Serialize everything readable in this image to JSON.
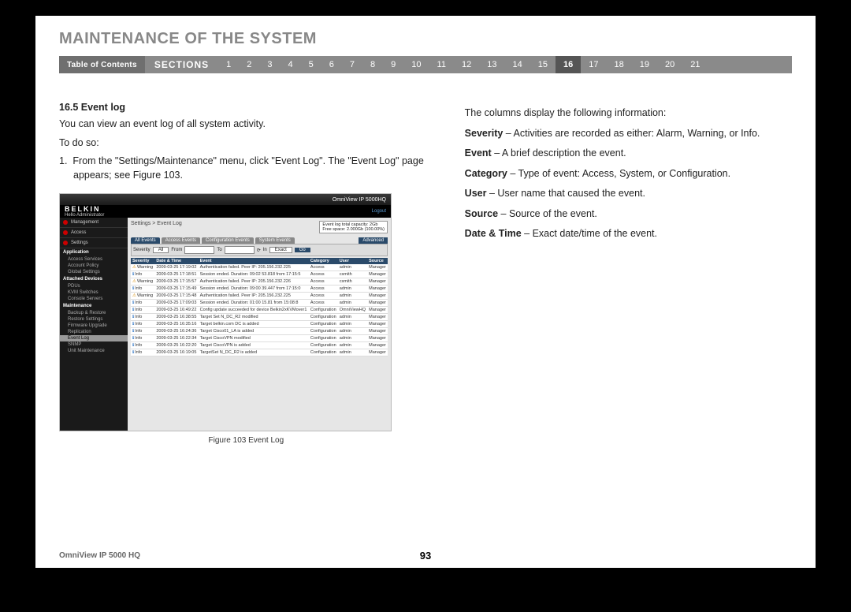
{
  "page": {
    "title": "MAINTENANCE OF THE SYSTEM",
    "toc_label": "Table of Contents",
    "sections_label": "SECTIONS",
    "section_numbers": [
      "1",
      "2",
      "3",
      "4",
      "5",
      "6",
      "7",
      "8",
      "9",
      "10",
      "11",
      "12",
      "13",
      "14",
      "15",
      "16",
      "17",
      "18",
      "19",
      "20",
      "21"
    ],
    "active_section": "16",
    "footer_product": "OmniView IP 5000 HQ",
    "page_number": "93"
  },
  "left": {
    "heading": "16.5 Event log",
    "intro": "You can view an event log of all system activity.",
    "todo": "To do so:",
    "step1_num": "1.",
    "step1": "From the \"Settings/Maintenance\" menu, click \"Event Log\". The \"Event Log\" page appears; see Figure 103.",
    "fig_caption": "Figure 103 Event Log"
  },
  "right": {
    "intro": "The columns display the following information:",
    "defs": [
      {
        "term": "Severity",
        "desc": " – Activities are recorded as either: Alarm, Warning, or Info."
      },
      {
        "term": "Event",
        "desc": " – A brief description the event."
      },
      {
        "term": "Category",
        "desc": " – Type of event: Access, System, or Configuration."
      },
      {
        "term": "User",
        "desc": " – User name that caused the event."
      },
      {
        "term": "Source",
        "desc": " – Source of the event."
      },
      {
        "term": "Date & Time",
        "desc": " – Exact date/time of the event."
      }
    ]
  },
  "fig": {
    "product_bar": "OmniView IP 5000HQ",
    "logo": "BELKIN",
    "hello": "Hello Administrator",
    "logout": "Logout",
    "side_top": [
      "Management",
      "Access",
      "Settings"
    ],
    "app_head": "Application",
    "app_items": [
      "Access Services",
      "Account Policy",
      "Global Settings"
    ],
    "dev_head": "Attached Devices",
    "dev_items": [
      "PDUs",
      "KVM Switches",
      "Console Servers"
    ],
    "maint_head": "Maintenance",
    "maint_items": [
      "Backup & Restore",
      "Restore Settings",
      "Firmware Upgrade",
      "Replication",
      "Event Log",
      "SNMP",
      "Unit Maintenance"
    ],
    "maint_active": "Event Log",
    "breadcrumb": "Settings > Event Log",
    "capacity_l1": "Event log total capacity: 2Gb",
    "capacity_l2": "Free space: 2.000Gb (100.00%)",
    "tabs": [
      "All Events",
      "Access Events",
      "Configuration Events",
      "System Events"
    ],
    "advanced": "Advanced",
    "filt_sev": "Severity",
    "filt_all": "All",
    "filt_from": "From",
    "filt_to": "To",
    "filt_in": "In",
    "filt_exact": "Exact",
    "filt_go": "Go",
    "cols": [
      "Severity",
      "Date & Time",
      "Event",
      "Category",
      "User",
      "Source"
    ],
    "rows": [
      {
        "sev": "Warning",
        "sevClass": "sev-warn",
        "dt": "2009-03-25 17:19:02",
        "ev": "Authentication failed. Peer IP: 205.156.232.225",
        "cat": "Access",
        "usr": "admin",
        "src": "Manager"
      },
      {
        "sev": "Info",
        "sevClass": "sev-info",
        "dt": "2009-03-25 17:18:51",
        "ev": "Session ended. Duration: 09:02 53.818 from 17:15:5",
        "cat": "Access",
        "usr": "csmith",
        "src": "Manager"
      },
      {
        "sev": "Warning",
        "sevClass": "sev-warn",
        "dt": "2009-03-25 17:15:57",
        "ev": "Authentication failed. Peer IP: 205.156.232.226",
        "cat": "Access",
        "usr": "csmith",
        "src": "Manager"
      },
      {
        "sev": "Info",
        "sevClass": "sev-info",
        "dt": "2009-03-25 17:15:49",
        "ev": "Session ended. Duration: 09:00 39.447 from 17:15:0",
        "cat": "Access",
        "usr": "admin",
        "src": "Manager"
      },
      {
        "sev": "Warning",
        "sevClass": "sev-warn",
        "dt": "2009-03-25 17:15:48",
        "ev": "Authentication failed. Peer IP: 205.156.232.225",
        "cat": "Access",
        "usr": "admin",
        "src": "Manager"
      },
      {
        "sev": "Info",
        "sevClass": "sev-info",
        "dt": "2009-03-25 17:09:03",
        "ev": "Session ended. Duration: 01:00 15.81 from 15:08:8",
        "cat": "Access",
        "usr": "admin",
        "src": "Manager"
      },
      {
        "sev": "Info",
        "sevClass": "sev-info",
        "dt": "2009-03-25 16:49:22",
        "ev": "Config update succeeded for device Belkin2xKVMover1",
        "cat": "Configuration",
        "usr": "OmniViewHQ",
        "src": "Manager"
      },
      {
        "sev": "Info",
        "sevClass": "sev-info",
        "dt": "2009-03-25 16:38:55",
        "ev": "Target Set N_DC_R2 modified",
        "cat": "Configuration",
        "usr": "admin",
        "src": "Manager"
      },
      {
        "sev": "Info",
        "sevClass": "sev-info",
        "dt": "2009-03-25 16:35:16",
        "ev": "Target belkin.com DC is added",
        "cat": "Configuration",
        "usr": "admin",
        "src": "Manager"
      },
      {
        "sev": "Info",
        "sevClass": "sev-info",
        "dt": "2009-03-25 16:24:36",
        "ev": "Target Cisco01_LA is added",
        "cat": "Configuration",
        "usr": "admin",
        "src": "Manager"
      },
      {
        "sev": "Info",
        "sevClass": "sev-info",
        "dt": "2009-03-25 16:22:34",
        "ev": "Target CiscoVPN modified",
        "cat": "Configuration",
        "usr": "admin",
        "src": "Manager"
      },
      {
        "sev": "Info",
        "sevClass": "sev-info",
        "dt": "2009-03-25 16:22:20",
        "ev": "Target CiscoVPN is added",
        "cat": "Configuration",
        "usr": "admin",
        "src": "Manager"
      },
      {
        "sev": "Info",
        "sevClass": "sev-info",
        "dt": "2009-03-25 16:19:05",
        "ev": "TargetSet N_DC_R2 is added",
        "cat": "Configuration",
        "usr": "admin",
        "src": "Manager"
      }
    ]
  }
}
